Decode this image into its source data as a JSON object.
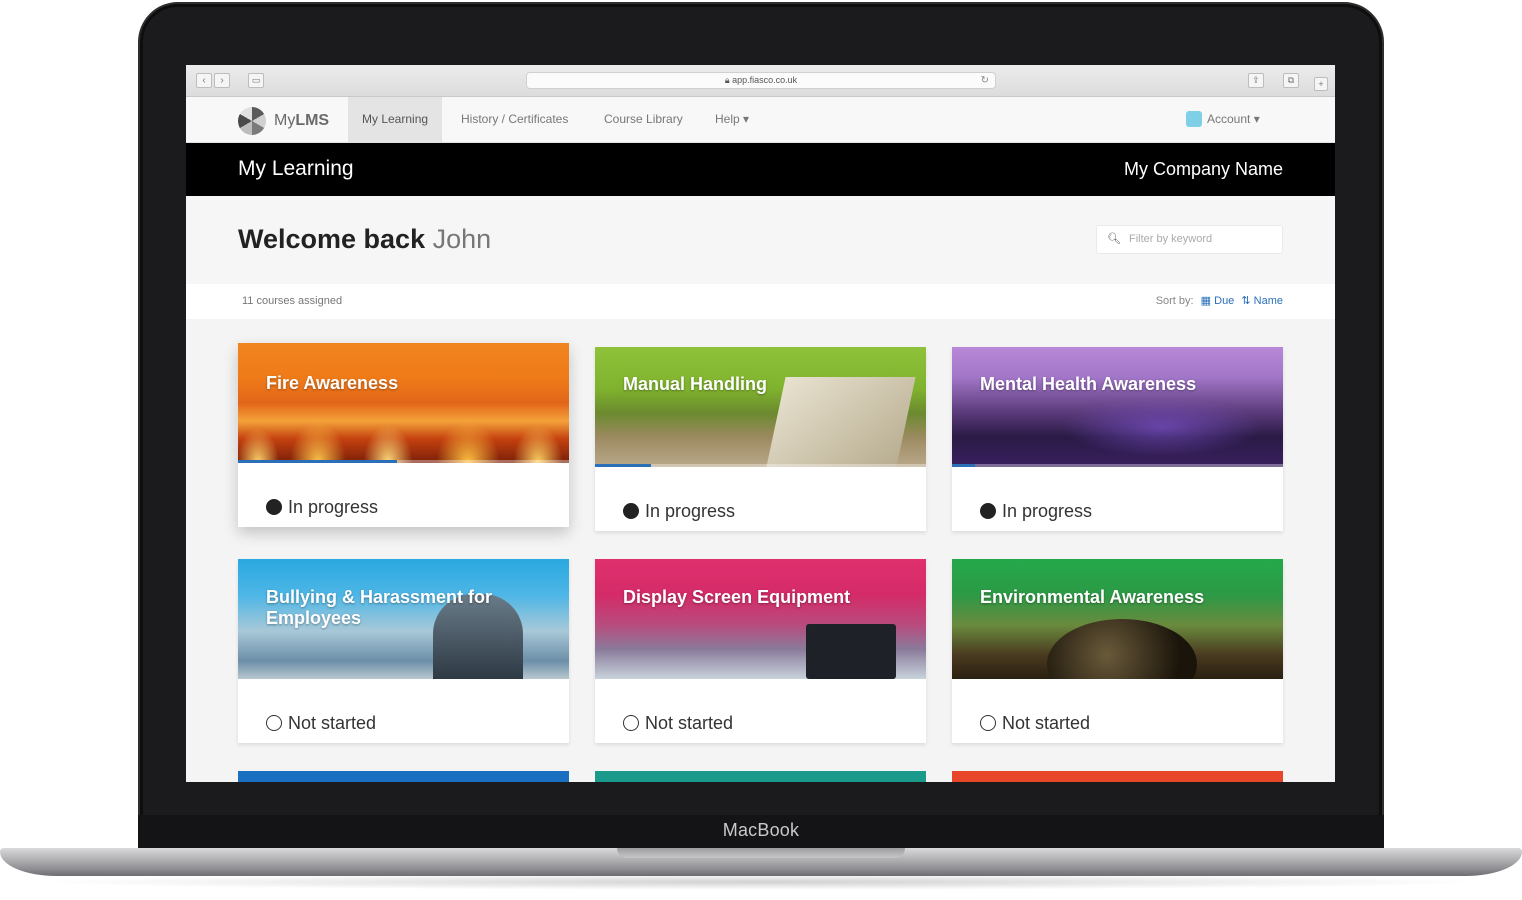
{
  "device": {
    "brand_label": "MacBook"
  },
  "browser": {
    "back_glyph": "‹",
    "forward_glyph": "›",
    "address": "app.fiasco.co.uk",
    "reload_glyph": "↻",
    "icons": [
      "back-icon",
      "forward-icon",
      "sidebar-icon",
      "lock-icon",
      "reload-icon",
      "share-icon",
      "tabs-icon",
      "new-tab-icon"
    ]
  },
  "nav": {
    "logo_prefix": "My",
    "logo_suffix": "LMS",
    "items": [
      {
        "label": "My Learning",
        "active": true
      },
      {
        "label": "History / Certificates",
        "active": false
      },
      {
        "label": "Course Library",
        "active": false
      },
      {
        "label": "Help ▾",
        "active": false
      }
    ],
    "account_label": "Account ▾"
  },
  "title_bar": {
    "page_title": "My Learning",
    "company_name": "My Company Name"
  },
  "welcome": {
    "greeting": "Welcome back",
    "user_name": "John",
    "filter_placeholder": "Filter by keyword",
    "filter_icon": "search-icon"
  },
  "list_info": {
    "count_text": "11 courses assigned",
    "sort_label": "Sort by:",
    "sort_options": [
      {
        "label": "Due",
        "icon": "calendar-icon"
      },
      {
        "label": "Name",
        "icon": "sort-alpha-icon"
      }
    ]
  },
  "courses": [
    {
      "title": "Fire Awareness",
      "status": "In progress",
      "status_type": "in-progress",
      "progress": 0.48,
      "color": "#f08520"
    },
    {
      "title": "Manual Handling",
      "status": "In progress",
      "status_type": "in-progress",
      "progress": 0.17,
      "color": "#8fc23a"
    },
    {
      "title": "Mental Health Awareness",
      "status": "In progress",
      "status_type": "in-progress",
      "progress": 0.07,
      "color": "#b988d8"
    },
    {
      "title": "Bullying & Harassment for Employees",
      "status": "Not started",
      "status_type": "not-started",
      "progress": 0,
      "color": "#2aa8e0"
    },
    {
      "title": "Display Screen Equipment",
      "status": "Not started",
      "status_type": "not-started",
      "progress": 0,
      "color": "#e0306e"
    },
    {
      "title": "Environmental Awareness",
      "status": "Not started",
      "status_type": "not-started",
      "progress": 0,
      "color": "#24a84a"
    }
  ],
  "peek_colors": [
    "#1a6fc0",
    "#1a9a8a",
    "#e8462a"
  ]
}
